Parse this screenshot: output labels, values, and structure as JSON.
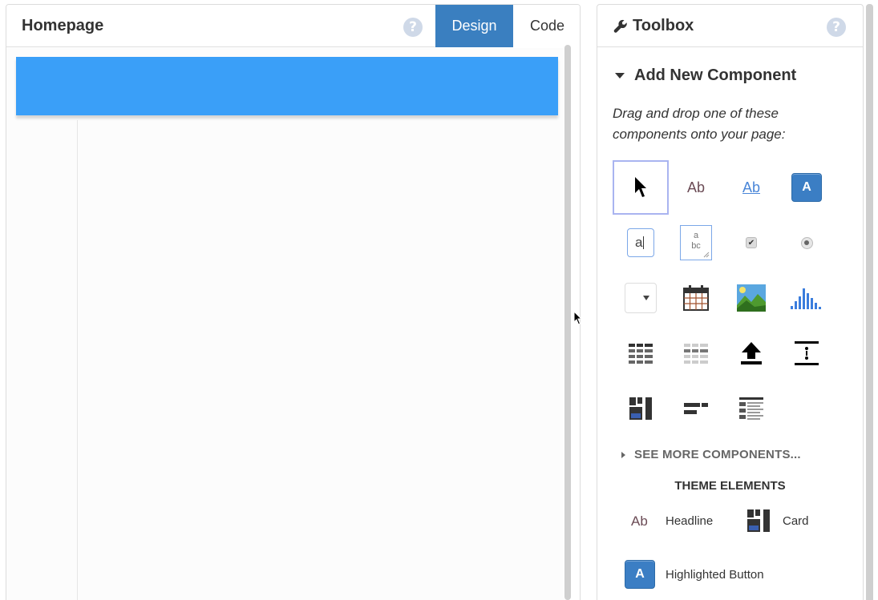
{
  "editor": {
    "title": "Homepage",
    "help_glyph": "?",
    "tabs": [
      {
        "label": "Design",
        "active": true
      },
      {
        "label": "Code",
        "active": false
      }
    ],
    "banner_color": "#3a9ff8"
  },
  "toolbox": {
    "title": "Toolbox",
    "help_glyph": "?",
    "section_title": "Add New Component",
    "drag_hint": "Drag and drop one of these components onto your page:",
    "components": [
      {
        "name": "pointer-icon",
        "label": ""
      },
      {
        "name": "label-icon",
        "label": "Ab"
      },
      {
        "name": "link-icon",
        "label": "Ab"
      },
      {
        "name": "button-icon",
        "label": "A"
      },
      {
        "name": "textbox-icon",
        "label": "a"
      },
      {
        "name": "textarea-icon",
        "label": "a bc"
      },
      {
        "name": "checkbox-icon",
        "label": ""
      },
      {
        "name": "radio-icon",
        "label": ""
      },
      {
        "name": "dropdown-icon",
        "label": ""
      },
      {
        "name": "calendar-icon",
        "label": ""
      },
      {
        "name": "image-icon",
        "label": ""
      },
      {
        "name": "chart-icon",
        "label": ""
      },
      {
        "name": "data-table-icon",
        "label": ""
      },
      {
        "name": "grid-icon",
        "label": ""
      },
      {
        "name": "file-upload-icon",
        "label": ""
      },
      {
        "name": "spacer-icon",
        "label": ""
      },
      {
        "name": "card-layout-icon",
        "label": ""
      },
      {
        "name": "flex-row-icon",
        "label": ""
      },
      {
        "name": "list-icon",
        "label": ""
      }
    ],
    "see_more": "SEE MORE COMPONENTS...",
    "theme_title": "THEME ELEMENTS",
    "theme_items": [
      {
        "icon_text": "Ab",
        "label": "Headline"
      },
      {
        "label": "Card"
      },
      {
        "icon_text": "A",
        "label": "Highlighted Button"
      }
    ],
    "accent_color": "#3b7ec4"
  }
}
